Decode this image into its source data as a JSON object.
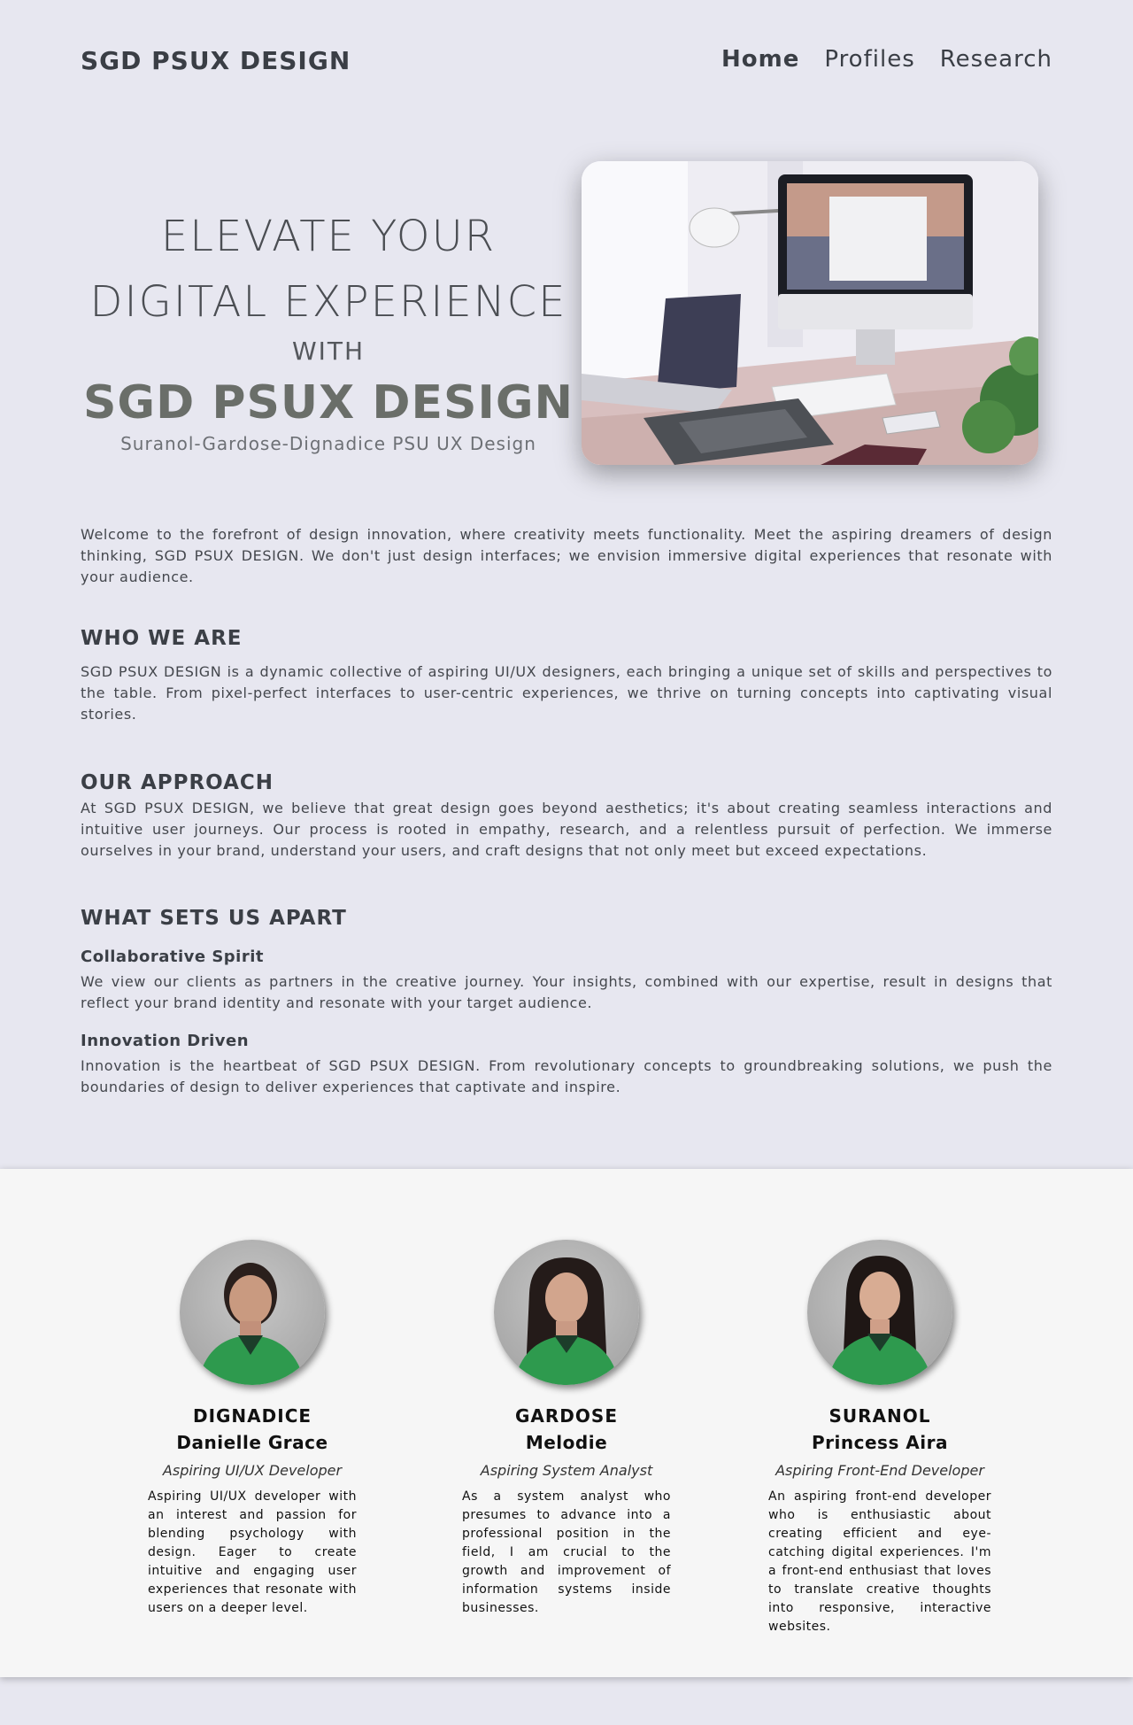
{
  "header": {
    "brand": "SGD PSUX DESIGN",
    "nav": [
      {
        "label": "Home",
        "active": true
      },
      {
        "label": "Profiles",
        "active": false
      },
      {
        "label": "Research",
        "active": false
      }
    ]
  },
  "hero": {
    "line1": "ELEVATE YOUR",
    "line2": "DIGITAL EXPERIENCE",
    "with": "WITH",
    "brand": "SGD PSUX DESIGN",
    "subtitle": "Suranol-Gardose-Dignadice PSU UX Design",
    "image": "desk-workspace-photo"
  },
  "intro": "Welcome to the forefront of design innovation, where creativity meets functionality. Meet the aspiring dreamers of design thinking, SGD PSUX DESIGN. We don't just design interfaces; we envision immersive digital experiences that resonate with your audience.",
  "who_we_are": {
    "title": "WHO WE ARE",
    "text": "SGD PSUX DESIGN is a dynamic collective of aspiring UI/UX designers, each bringing a unique set of skills and perspectives to the table. From pixel-perfect interfaces to user-centric experiences, we thrive on turning concepts into captivating visual stories."
  },
  "approach": {
    "title": "OUR APPROACH",
    "text": "At SGD PSUX DESIGN, we believe that great design goes beyond aesthetics; it's about creating seamless interactions and intuitive user journeys. Our process is rooted in empathy, research, and a relentless pursuit of perfection. We immerse ourselves in your brand, understand your users, and craft designs that not only meet but exceed expectations."
  },
  "apart": {
    "title": "WHAT SETS US APART",
    "items": [
      {
        "title": "Collaborative Spirit",
        "text": "We view our clients as partners in the creative journey. Your insights, combined with our expertise, result in designs that reflect your brand identity and resonate with your target audience."
      },
      {
        "title": "Innovation Driven",
        "text": "Innovation is the heartbeat of SGD PSUX DESIGN. From revolutionary concepts to groundbreaking solutions, we push the boundaries of design to deliver experiences that captivate and inspire."
      }
    ]
  },
  "team": [
    {
      "last": "DIGNADICE",
      "first": "Danielle Grace",
      "role": "Aspiring UI/UX Developer",
      "desc": "Aspiring UI/UX developer with an interest and passion for blending psychology with design. Eager to create intuitive and engaging user experiences that resonate with users on a deeper level."
    },
    {
      "last": "GARDOSE",
      "first": "Melodie",
      "role": "Aspiring System Analyst",
      "desc": "As a system analyst who presumes to advance into a professional position in the field, I am crucial to the growth and improvement of information systems inside businesses."
    },
    {
      "last": "SURANOL",
      "first": "Princess Aira",
      "role": "Aspiring Front-End Developer",
      "desc": "An aspiring front-end developer who is enthusiastic about creating efficient and eye-catching digital experiences. I'm a front-end enthusiast that loves to translate creative thoughts into responsive, interactive websites."
    }
  ]
}
